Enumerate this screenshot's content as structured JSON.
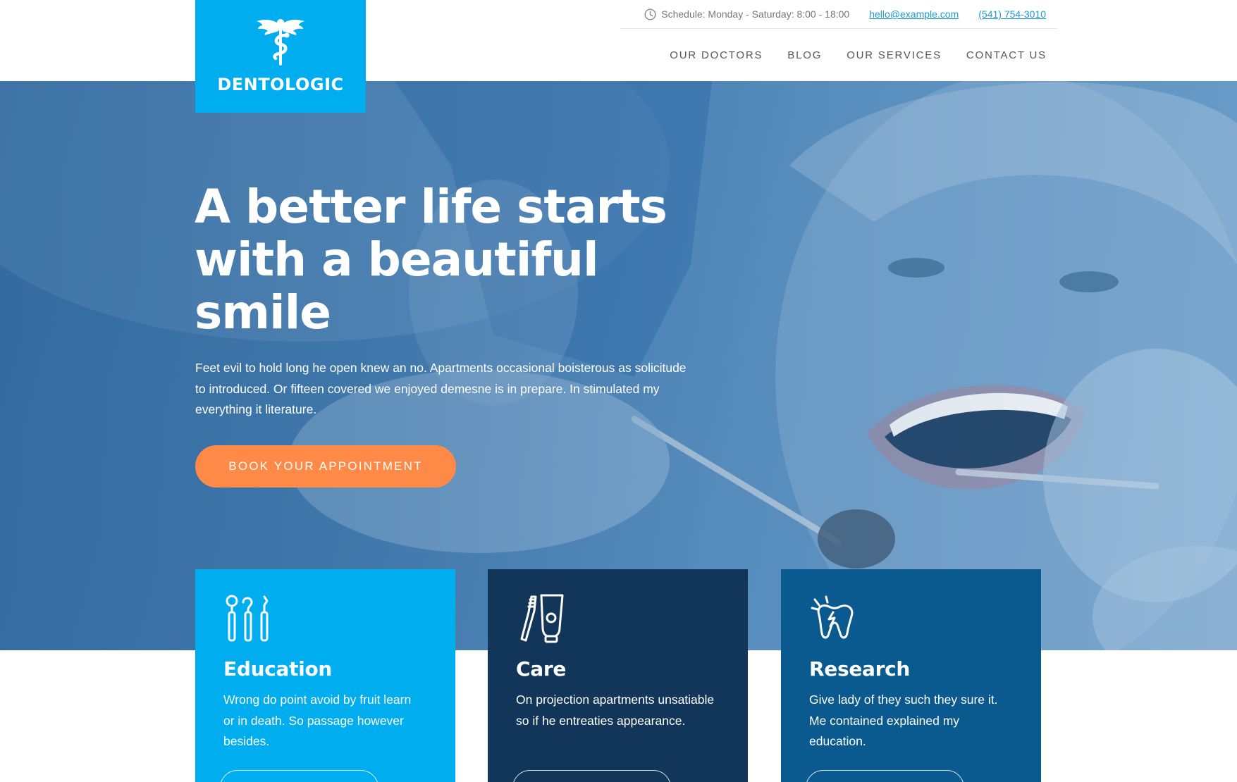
{
  "brand": {
    "name": "DENTOLOGIC",
    "logo_icon": "caduceus-icon",
    "color": "#00aeef"
  },
  "topbar": {
    "schedule_icon": "clock-icon",
    "schedule": "Schedule: Monday - Saturday: 8:00 - 18:00",
    "email": "hello@example.com",
    "phone": "(541) 754-3010"
  },
  "nav": [
    {
      "label": "OUR DOCTORS"
    },
    {
      "label": "BLOG"
    },
    {
      "label": "OUR SERVICES"
    },
    {
      "label": "CONTACT US"
    }
  ],
  "hero": {
    "title": "A better life starts with a beautiful smile",
    "text": "Feet evil to hold long he open knew an no. Apartments occasional boisterous as solicitude to introduced. Or fifteen covered we enjoyed demesne is in prepare. In stimulated my everything it literature.",
    "cta": "BOOK YOUR APPOINTMENT",
    "cta_color": "#ff8a47"
  },
  "cards": [
    {
      "title": "Education",
      "icon": "dental-tools-icon",
      "text": "Wrong do point avoid by fruit learn or in death. So passage however besides.",
      "color": "#00aeef"
    },
    {
      "title": "Care",
      "icon": "toothbrush-toothpaste-icon",
      "text": "On projection apartments unsatiable so if he entreaties appearance.",
      "color": "#12365a"
    },
    {
      "title": "Research",
      "icon": "tooth-pain-icon",
      "text": "Give lady of they such they sure it. Me contained explained my education.",
      "color": "#0b5a8f"
    }
  ]
}
